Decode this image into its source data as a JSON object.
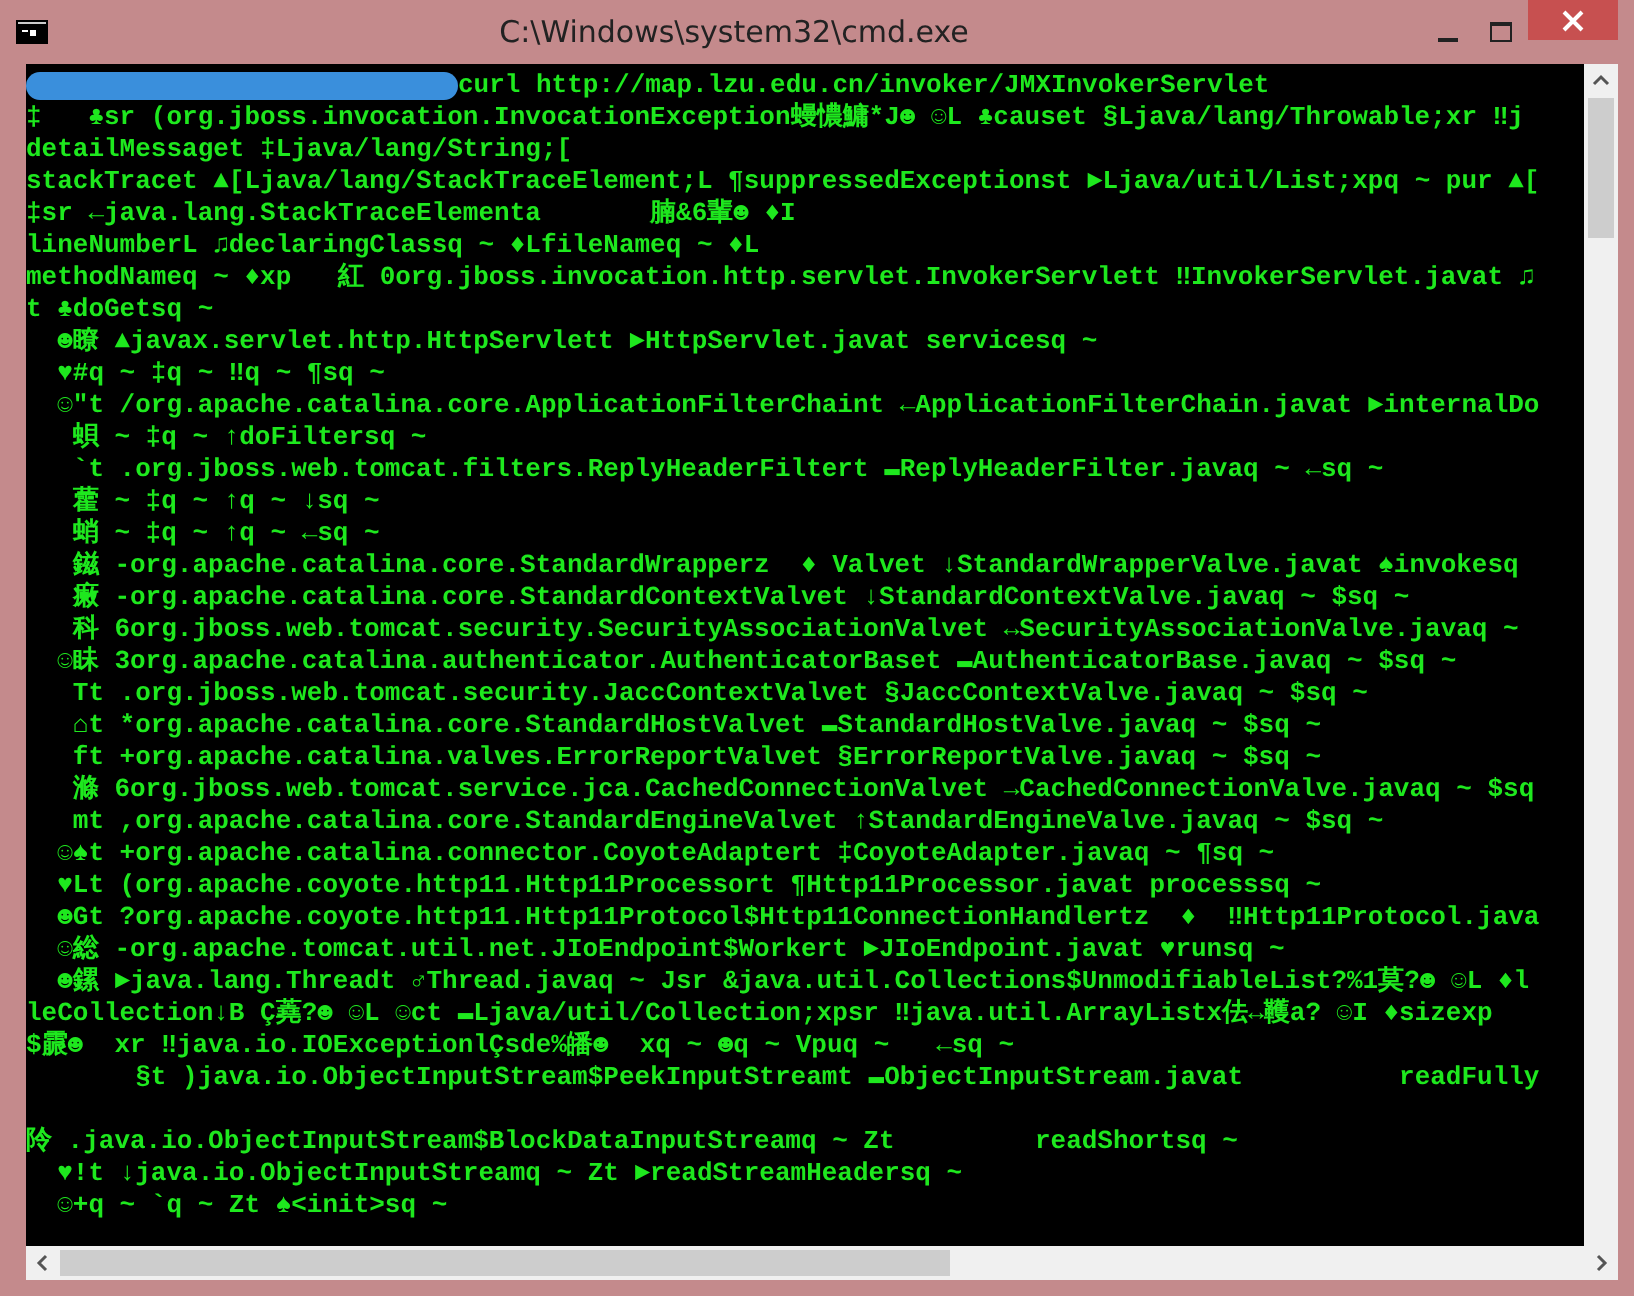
{
  "window": {
    "title": "C:\\Windows\\system32\\cmd.exe"
  },
  "prompt": {
    "redacted": true,
    "command": "curl http://map.lzu.edu.cn/invoker/JMXInvokerServlet"
  },
  "output_lines": [
    {
      "kind": "text",
      "text": "‡   ♣sr (org.jboss.invocation.InvocationException蟃憹鱅*J☻ ☺L ♣causet §Ljava/lang/Throwable;xr ‼j"
    },
    {
      "kind": "text",
      "text": "detailMessaget ‡Ljava/lang/String;["
    },
    {
      "kind": "text",
      "text": "stackTracet ▲[Ljava/lang/StackTraceElement;L ¶suppressedExceptionst ►Ljava/util/List;xpq ~ pur ▲["
    },
    {
      "kind": "text",
      "text": "‡sr ←java.lang.StackTraceElementa       腩&6輩☻ ♦I"
    },
    {
      "kind": "text",
      "text": "lineNumberL ♫declaringClassq ~ ♦LfileNameq ~ ♦L"
    },
    {
      "kind": "text",
      "text": "methodNameq ~ ♦xp   紅 0org.jboss.invocation.http.servlet.InvokerServlett ‼InvokerServlet.javat ♫"
    },
    {
      "kind": "text",
      "text": "t ♣doGetsq ~"
    },
    {
      "kind": "text",
      "text": "  ☻瞭 ▲javax.servlet.http.HttpServlett ►HttpServlet.javat servicesq ~"
    },
    {
      "kind": "text",
      "text": "  ♥#q ~ ‡q ~ ‼q ~ ¶sq ~"
    },
    {
      "kind": "text",
      "text": "  ☺\"t /org.apache.catalina.core.ApplicationFilterChaint ←ApplicationFilterChain.javat ►internalDo"
    },
    {
      "kind": "text",
      "text": "   蛽 ~ ‡q ~ ↑doFiltersq ~"
    },
    {
      "kind": "text",
      "text": "   `t .org.jboss.web.tomcat.filters.ReplyHeaderFiltert ▬ReplyHeaderFilter.javaq ~ ←sq ~"
    },
    {
      "kind": "text",
      "text": "   藿 ~ ‡q ~ ↑q ~ ↓sq ~"
    },
    {
      "kind": "text",
      "text": "   蛸 ~ ‡q ~ ↑q ~ ←sq ~"
    },
    {
      "kind": "text",
      "text": "   鎡 -org.apache.catalina.core.StandardWrapperz  ♦ Valvet ↓StandardWrapperValve.javat ♠invokesq"
    },
    {
      "kind": "text",
      "text": "   瘷 -org.apache.catalina.core.StandardContextValvet ↓StandardContextValve.javaq ~ $sq ~"
    },
    {
      "kind": "text",
      "text": "   科 6org.jboss.web.tomcat.security.SecurityAssociationValvet ↔SecurityAssociationValve.javaq ~"
    },
    {
      "kind": "text",
      "text": "  ☺眛 3org.apache.catalina.authenticator.AuthenticatorBaset ▬AuthenticatorBase.javaq ~ $sq ~"
    },
    {
      "kind": "text",
      "text": "   Tt .org.jboss.web.tomcat.security.JaccContextValvet §JaccContextValve.javaq ~ $sq ~"
    },
    {
      "kind": "text",
      "text": "   ⌂t *org.apache.catalina.core.StandardHostValvet ▬StandardHostValve.javaq ~ $sq ~"
    },
    {
      "kind": "text",
      "text": "   ft +org.apache.catalina.valves.ErrorReportValvet §ErrorReportValve.javaq ~ $sq ~"
    },
    {
      "kind": "text",
      "text": "   滌 6org.jboss.web.tomcat.service.jca.CachedConnectionValvet →CachedConnectionValve.javaq ~ $sq"
    },
    {
      "kind": "text",
      "text": "   mt ,org.apache.catalina.core.StandardEngineValvet ↑StandardEngineValve.javaq ~ $sq ~"
    },
    {
      "kind": "text",
      "text": "  ☺♠t +org.apache.catalina.connector.CoyoteAdaptert ‡CoyoteAdapter.javaq ~ ¶sq ~"
    },
    {
      "kind": "text",
      "text": "  ♥Lt (org.apache.coyote.http11.Http11Processort ¶Http11Processor.javat processsq ~"
    },
    {
      "kind": "text",
      "text": "  ☻Gt ?org.apache.coyote.http11.Http11Protocol$Http11ConnectionHandlertz  ♦  ‼Http11Protocol.java"
    },
    {
      "kind": "text",
      "text": "  ☺総 -org.apache.tomcat.util.net.JIoEndpoint$Workert ►JIoEndpoint.javat ♥runsq ~"
    },
    {
      "kind": "text",
      "text": "  ☻鏍 ►java.lang.Threadt ♂Thread.javaq ~ Jsr &java.util.Collections$UnmodifiableList?%1莫?☻ ☺L ♦l"
    },
    {
      "kind": "text",
      "text": "leCollection↓B Ç蕘?☻ ☺L ☺ct ▬Ljava/util/Collection;xpsr ‼java.util.ArrayListx佉↔韄a? ☺I ♦sizexp"
    },
    {
      "kind": "text",
      "text": "$霢☻  xr ‼java.io.IOExceptionlÇsde%皤☻  xq ~ ☻q ~ Vpuq ~   ←sq ~"
    },
    {
      "kind": "text",
      "text": "       §t )java.io.ObjectInputStream$PeekInputStreamt ▬ObjectInputStream.javat          readFully"
    },
    {
      "kind": "blank"
    },
    {
      "kind": "text",
      "text": "阾 .java.io.ObjectInputStream$BlockDataInputStreamq ~ Zt         readShortsq ~"
    },
    {
      "kind": "text",
      "text": "  ♥!t ↓java.io.ObjectInputStreamq ~ Zt ►readStreamHeadersq ~"
    },
    {
      "kind": "text",
      "text": "  ☺+q ~ `q ~ Zt ♠<init>sq ~"
    }
  ]
}
